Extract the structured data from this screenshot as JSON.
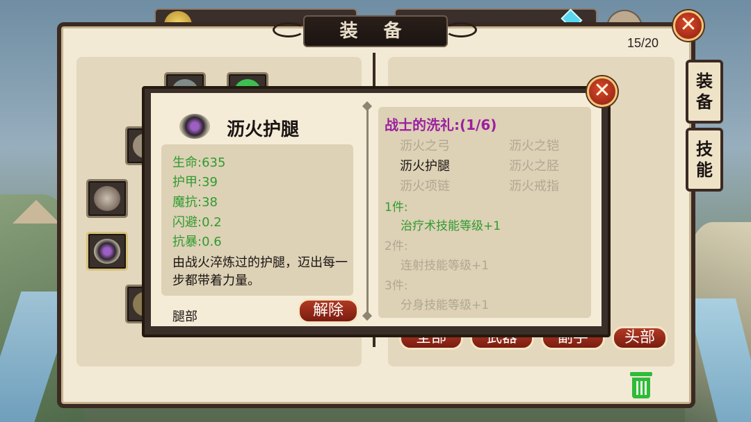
{
  "window": {
    "title": "装 备",
    "bag_count": "15/20",
    "close_icon_glyph": "✕"
  },
  "side_tabs": [
    {
      "label": "装\n备"
    },
    {
      "label": "技\n能"
    }
  ],
  "filters": [
    {
      "label": "全部"
    },
    {
      "label": "武器"
    },
    {
      "label": "副手"
    },
    {
      "label": "头部"
    }
  ],
  "item": {
    "name": "沥火护腿",
    "stats": [
      "生命:635",
      "护甲:39",
      "魔抗:38",
      "闪避:0.2",
      "抗暴:0.6"
    ],
    "description": "由战火淬炼过的护腿，迈出每一步都带着力量。",
    "slot": "腿部",
    "unequip_label": "解除"
  },
  "set": {
    "title": "战士的洗礼:(1/6)",
    "pieces": [
      {
        "name": "沥火之弓",
        "owned": false
      },
      {
        "name": "沥火之铠",
        "owned": false
      },
      {
        "name": "沥火护腿",
        "owned": true
      },
      {
        "name": "沥火之胫",
        "owned": false
      },
      {
        "name": "沥火项链",
        "owned": false
      },
      {
        "name": "沥火戒指",
        "owned": false
      }
    ],
    "bonuses": [
      {
        "tier": "1件:",
        "effect": "治疗术技能等级+1",
        "active": true
      },
      {
        "tier": "2件:",
        "effect": "连射技能等级+1",
        "active": false
      },
      {
        "tier": "3件:",
        "effect": "分身技能等级+1",
        "active": false
      }
    ]
  },
  "colors": {
    "stat_green": "#2f9b2f",
    "set_purple": "#9b1fa0",
    "inactive_gray": "#b0a892",
    "button_red": "#b13a24",
    "panel_dark": "#3b2a22"
  },
  "icons": [
    "close-icon",
    "trash-icon",
    "coin-icon",
    "gem-icon",
    "leg-armor-icon"
  ]
}
